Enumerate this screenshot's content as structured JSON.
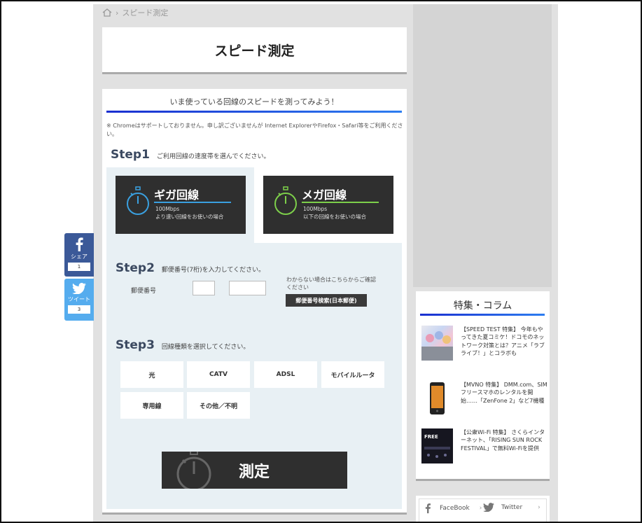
{
  "breadcrumb": {
    "current": "スピード測定"
  },
  "page": {
    "title": "スピード測定"
  },
  "intro": {
    "heading": "いま使っている回線のスピードを測ってみよう！",
    "note": "※ Chromeはサポートしておりません。申し訳ございませんが Internet ExplorerやFirefox・Safari等をご利用ください。"
  },
  "step1": {
    "label": "Step1",
    "instruction": "ご利用回線の速度帯を選んでください。",
    "giga": {
      "title": "ギガ回線",
      "speed": "100Mbps",
      "desc": "より速い回線をお使いの場合"
    },
    "mega": {
      "title": "メガ回線",
      "speed": "100Mbps",
      "desc": "以下の回線をお使いの場合"
    }
  },
  "step2": {
    "label": "Step2",
    "instruction": "郵便番号(7桁)を入力してください。",
    "zip_label": "郵便番号",
    "help": "わからない場合はこちらからご確認ください",
    "search_button": "郵便番号検索(日本郵便)"
  },
  "step3": {
    "label": "Step3",
    "instruction": "回線種類を選択してください。",
    "options": [
      "光",
      "CATV",
      "ADSL",
      "モバイルルータ",
      "専用線",
      "その他／不明"
    ]
  },
  "measure": {
    "label": "測定"
  },
  "social": {
    "share": {
      "label": "シェア",
      "count": "1"
    },
    "tweet": {
      "label": "ツイート",
      "count": "3"
    }
  },
  "column": {
    "title": "特集・コラム",
    "articles": [
      {
        "text": "【SPEED TEST 特集】 今年もやってきた夏コミケ！ドコモのネットワーク対策とは？アニメ「ラブライブ！」とコラボも"
      },
      {
        "text": "【MVNO 特集】 DMM.com、SIMフリースマホのレンタルを開始……「ZenFone 2」など7機種"
      },
      {
        "text": "【公衆Wi-Fi 特集】 さくらインターネット、「RISING SUN ROCK FESTIVAL」で無料Wi-Fiを提供"
      }
    ],
    "thumb3_text": "FREE"
  },
  "follow": {
    "facebook": "FaceBook",
    "twitter": "Twitter"
  },
  "colors": {
    "accent": "#1a2fd0",
    "giga": "#3aa0e0",
    "mega": "#7dcf4a",
    "facebook": "#3b5998",
    "twitter": "#55acee"
  }
}
